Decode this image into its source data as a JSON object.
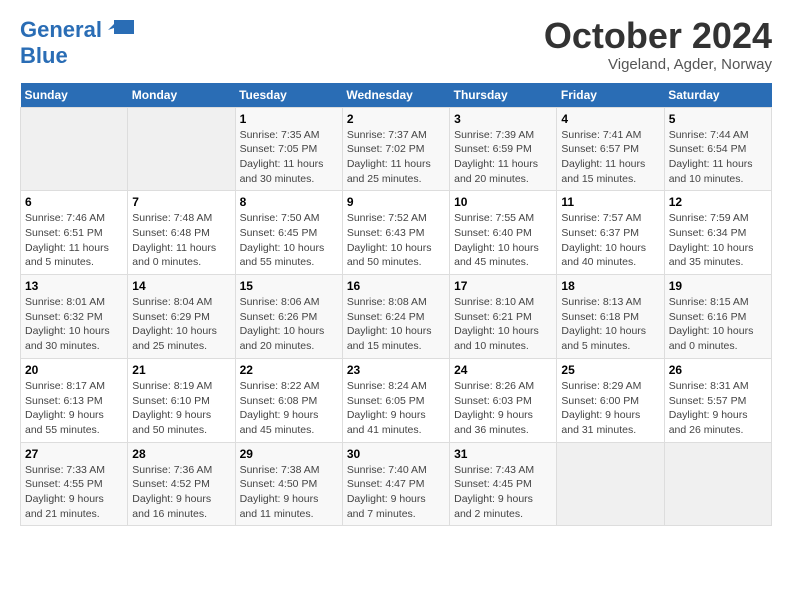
{
  "logo": {
    "line1": "General",
    "line2": "Blue"
  },
  "title": "October 2024",
  "subtitle": "Vigeland, Agder, Norway",
  "header_days": [
    "Sunday",
    "Monday",
    "Tuesday",
    "Wednesday",
    "Thursday",
    "Friday",
    "Saturday"
  ],
  "weeks": [
    [
      {
        "day": "",
        "info": ""
      },
      {
        "day": "",
        "info": ""
      },
      {
        "day": "1",
        "info": "Sunrise: 7:35 AM\nSunset: 7:05 PM\nDaylight: 11 hours\nand 30 minutes."
      },
      {
        "day": "2",
        "info": "Sunrise: 7:37 AM\nSunset: 7:02 PM\nDaylight: 11 hours\nand 25 minutes."
      },
      {
        "day": "3",
        "info": "Sunrise: 7:39 AM\nSunset: 6:59 PM\nDaylight: 11 hours\nand 20 minutes."
      },
      {
        "day": "4",
        "info": "Sunrise: 7:41 AM\nSunset: 6:57 PM\nDaylight: 11 hours\nand 15 minutes."
      },
      {
        "day": "5",
        "info": "Sunrise: 7:44 AM\nSunset: 6:54 PM\nDaylight: 11 hours\nand 10 minutes."
      }
    ],
    [
      {
        "day": "6",
        "info": "Sunrise: 7:46 AM\nSunset: 6:51 PM\nDaylight: 11 hours\nand 5 minutes."
      },
      {
        "day": "7",
        "info": "Sunrise: 7:48 AM\nSunset: 6:48 PM\nDaylight: 11 hours\nand 0 minutes."
      },
      {
        "day": "8",
        "info": "Sunrise: 7:50 AM\nSunset: 6:45 PM\nDaylight: 10 hours\nand 55 minutes."
      },
      {
        "day": "9",
        "info": "Sunrise: 7:52 AM\nSunset: 6:43 PM\nDaylight: 10 hours\nand 50 minutes."
      },
      {
        "day": "10",
        "info": "Sunrise: 7:55 AM\nSunset: 6:40 PM\nDaylight: 10 hours\nand 45 minutes."
      },
      {
        "day": "11",
        "info": "Sunrise: 7:57 AM\nSunset: 6:37 PM\nDaylight: 10 hours\nand 40 minutes."
      },
      {
        "day": "12",
        "info": "Sunrise: 7:59 AM\nSunset: 6:34 PM\nDaylight: 10 hours\nand 35 minutes."
      }
    ],
    [
      {
        "day": "13",
        "info": "Sunrise: 8:01 AM\nSunset: 6:32 PM\nDaylight: 10 hours\nand 30 minutes."
      },
      {
        "day": "14",
        "info": "Sunrise: 8:04 AM\nSunset: 6:29 PM\nDaylight: 10 hours\nand 25 minutes."
      },
      {
        "day": "15",
        "info": "Sunrise: 8:06 AM\nSunset: 6:26 PM\nDaylight: 10 hours\nand 20 minutes."
      },
      {
        "day": "16",
        "info": "Sunrise: 8:08 AM\nSunset: 6:24 PM\nDaylight: 10 hours\nand 15 minutes."
      },
      {
        "day": "17",
        "info": "Sunrise: 8:10 AM\nSunset: 6:21 PM\nDaylight: 10 hours\nand 10 minutes."
      },
      {
        "day": "18",
        "info": "Sunrise: 8:13 AM\nSunset: 6:18 PM\nDaylight: 10 hours\nand 5 minutes."
      },
      {
        "day": "19",
        "info": "Sunrise: 8:15 AM\nSunset: 6:16 PM\nDaylight: 10 hours\nand 0 minutes."
      }
    ],
    [
      {
        "day": "20",
        "info": "Sunrise: 8:17 AM\nSunset: 6:13 PM\nDaylight: 9 hours\nand 55 minutes."
      },
      {
        "day": "21",
        "info": "Sunrise: 8:19 AM\nSunset: 6:10 PM\nDaylight: 9 hours\nand 50 minutes."
      },
      {
        "day": "22",
        "info": "Sunrise: 8:22 AM\nSunset: 6:08 PM\nDaylight: 9 hours\nand 45 minutes."
      },
      {
        "day": "23",
        "info": "Sunrise: 8:24 AM\nSunset: 6:05 PM\nDaylight: 9 hours\nand 41 minutes."
      },
      {
        "day": "24",
        "info": "Sunrise: 8:26 AM\nSunset: 6:03 PM\nDaylight: 9 hours\nand 36 minutes."
      },
      {
        "day": "25",
        "info": "Sunrise: 8:29 AM\nSunset: 6:00 PM\nDaylight: 9 hours\nand 31 minutes."
      },
      {
        "day": "26",
        "info": "Sunrise: 8:31 AM\nSunset: 5:57 PM\nDaylight: 9 hours\nand 26 minutes."
      }
    ],
    [
      {
        "day": "27",
        "info": "Sunrise: 7:33 AM\nSunset: 4:55 PM\nDaylight: 9 hours\nand 21 minutes."
      },
      {
        "day": "28",
        "info": "Sunrise: 7:36 AM\nSunset: 4:52 PM\nDaylight: 9 hours\nand 16 minutes."
      },
      {
        "day": "29",
        "info": "Sunrise: 7:38 AM\nSunset: 4:50 PM\nDaylight: 9 hours\nand 11 minutes."
      },
      {
        "day": "30",
        "info": "Sunrise: 7:40 AM\nSunset: 4:47 PM\nDaylight: 9 hours\nand 7 minutes."
      },
      {
        "day": "31",
        "info": "Sunrise: 7:43 AM\nSunset: 4:45 PM\nDaylight: 9 hours\nand 2 minutes."
      },
      {
        "day": "",
        "info": ""
      },
      {
        "day": "",
        "info": ""
      }
    ]
  ]
}
